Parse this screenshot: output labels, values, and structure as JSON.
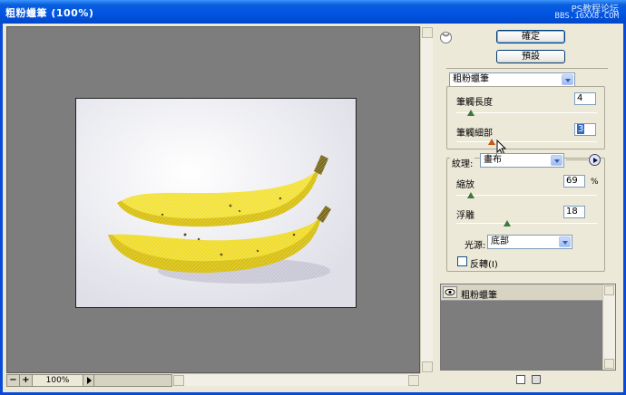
{
  "window": {
    "title": "粗粉蠟筆 (100%)",
    "watermark_line1": "PS教程论坛",
    "watermark_line2": "BBS.16XX8.COM"
  },
  "preview": {
    "zoom": "100%",
    "zoom_minus": "−",
    "zoom_plus": "+"
  },
  "buttons": {
    "ok": "確定",
    "default": "預設"
  },
  "filter_select": "粗粉蠟筆",
  "stroke": {
    "length_label": "筆觸長度",
    "length_value": "4",
    "length_fraction": 0.1,
    "detail_label": "筆觸細部",
    "detail_value": "3",
    "detail_fraction": 0.25
  },
  "texture": {
    "label": "紋理:",
    "value": "畫布",
    "scaling_label": "縮放",
    "scaling_value": "69",
    "scaling_unit": "%",
    "scaling_fraction": 0.1,
    "relief_label": "浮雕",
    "relief_value": "18",
    "relief_fraction": 0.36,
    "light_label": "光源:",
    "light_value": "底部",
    "invert_label": "反轉(I)",
    "invert_checked": false
  },
  "layers": {
    "items": [
      {
        "name": "粗粉蠟筆"
      }
    ]
  },
  "colors": {
    "titlebar": "#0054e3",
    "preview_bg": "#7d7d7d",
    "panel_bg": "#ece9d8",
    "banana": "#e9d21a"
  }
}
